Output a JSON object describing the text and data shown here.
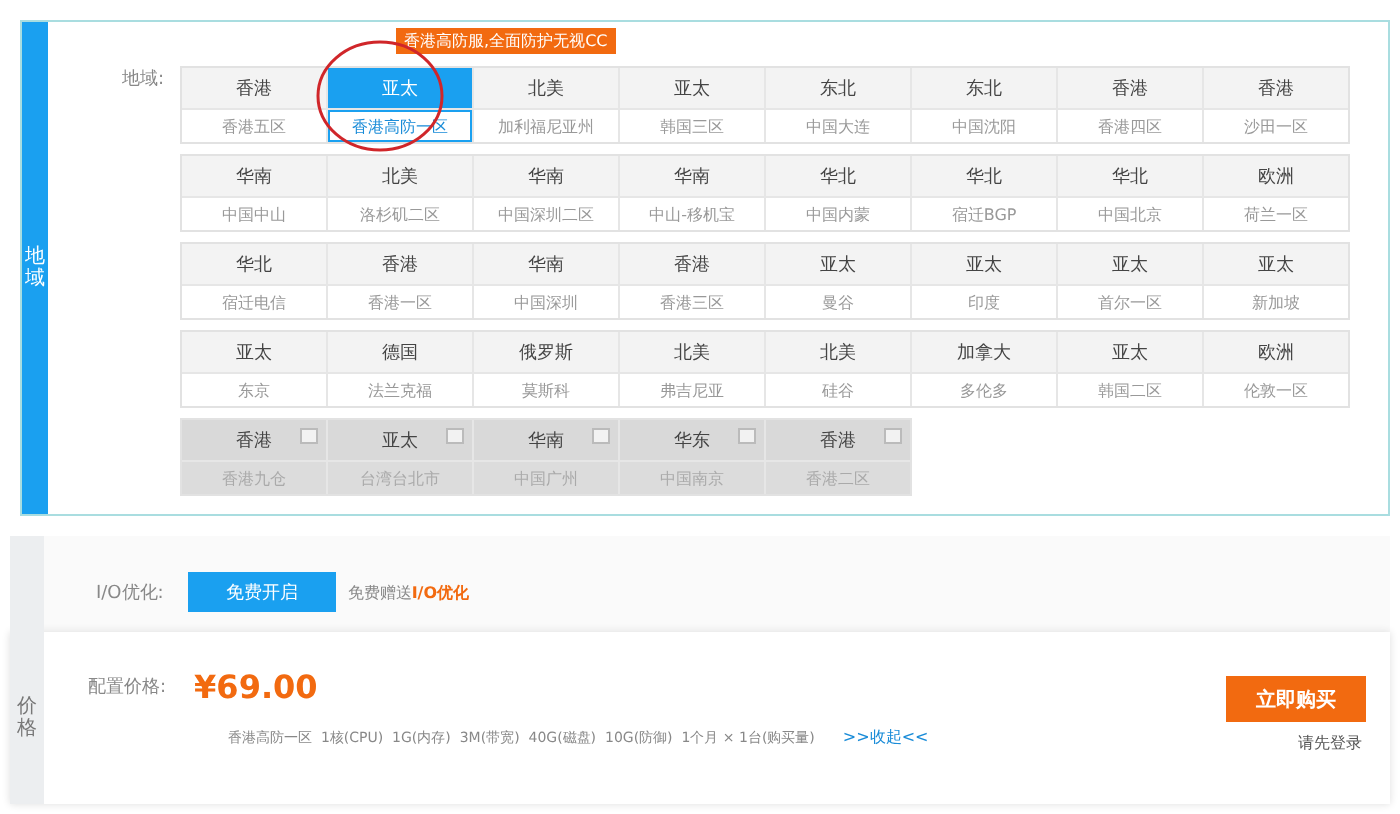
{
  "region_section": {
    "side_label": "地域",
    "label": "地域:",
    "tooltip": "香港高防服,全面防护无视CC",
    "rows": [
      [
        {
          "area": "香港",
          "name": "香港五区",
          "selected": false,
          "disabled": false
        },
        {
          "area": "亚太",
          "name": "香港高防一区",
          "selected": true,
          "disabled": false
        },
        {
          "area": "北美",
          "name": "加利福尼亚州",
          "selected": false,
          "disabled": false
        },
        {
          "area": "亚太",
          "name": "韩国三区",
          "selected": false,
          "disabled": false
        },
        {
          "area": "东北",
          "name": "中国大连",
          "selected": false,
          "disabled": false
        },
        {
          "area": "东北",
          "name": "中国沈阳",
          "selected": false,
          "disabled": false
        },
        {
          "area": "香港",
          "name": "香港四区",
          "selected": false,
          "disabled": false
        },
        {
          "area": "香港",
          "name": "沙田一区",
          "selected": false,
          "disabled": false
        }
      ],
      [
        {
          "area": "华南",
          "name": "中国中山",
          "selected": false,
          "disabled": false
        },
        {
          "area": "北美",
          "name": "洛杉矶二区",
          "selected": false,
          "disabled": false
        },
        {
          "area": "华南",
          "name": "中国深圳二区",
          "selected": false,
          "disabled": false
        },
        {
          "area": "华南",
          "name": "中山-移机宝",
          "selected": false,
          "disabled": false
        },
        {
          "area": "华北",
          "name": "中国内蒙",
          "selected": false,
          "disabled": false
        },
        {
          "area": "华北",
          "name": "宿迁BGP",
          "selected": false,
          "disabled": false
        },
        {
          "area": "华北",
          "name": "中国北京",
          "selected": false,
          "disabled": false
        },
        {
          "area": "欧洲",
          "name": "荷兰一区",
          "selected": false,
          "disabled": false
        }
      ],
      [
        {
          "area": "华北",
          "name": "宿迁电信",
          "selected": false,
          "disabled": false
        },
        {
          "area": "香港",
          "name": "香港一区",
          "selected": false,
          "disabled": false
        },
        {
          "area": "华南",
          "name": "中国深圳",
          "selected": false,
          "disabled": false
        },
        {
          "area": "香港",
          "name": "香港三区",
          "selected": false,
          "disabled": false
        },
        {
          "area": "亚太",
          "name": "曼谷",
          "selected": false,
          "disabled": false
        },
        {
          "area": "亚太",
          "name": "印度",
          "selected": false,
          "disabled": false
        },
        {
          "area": "亚太",
          "name": "首尔一区",
          "selected": false,
          "disabled": false
        },
        {
          "area": "亚太",
          "name": "新加坡",
          "selected": false,
          "disabled": false
        }
      ],
      [
        {
          "area": "亚太",
          "name": "东京",
          "selected": false,
          "disabled": false
        },
        {
          "area": "德国",
          "name": "法兰克福",
          "selected": false,
          "disabled": false
        },
        {
          "area": "俄罗斯",
          "name": "莫斯科",
          "selected": false,
          "disabled": false
        },
        {
          "area": "北美",
          "name": "弗吉尼亚",
          "selected": false,
          "disabled": false
        },
        {
          "area": "北美",
          "name": "硅谷",
          "selected": false,
          "disabled": false
        },
        {
          "area": "加拿大",
          "name": "多伦多",
          "selected": false,
          "disabled": false
        },
        {
          "area": "亚太",
          "name": "韩国二区",
          "selected": false,
          "disabled": false
        },
        {
          "area": "欧洲",
          "name": "伦敦一区",
          "selected": false,
          "disabled": false
        }
      ],
      [
        {
          "area": "香港",
          "name": "香港九仓",
          "selected": false,
          "disabled": true
        },
        {
          "area": "亚太",
          "name": "台湾台北市",
          "selected": false,
          "disabled": true
        },
        {
          "area": "华南",
          "name": "中国广州",
          "selected": false,
          "disabled": true
        },
        {
          "area": "华东",
          "name": "中国南京",
          "selected": false,
          "disabled": true
        },
        {
          "area": "香港",
          "name": "香港二区",
          "selected": false,
          "disabled": true
        }
      ]
    ]
  },
  "io_section": {
    "label": "I/O优化:",
    "button": "免费开启",
    "note": "免费赠送**I/O优化**"
  },
  "price_section": {
    "side_label": "价格",
    "label": "配置价格:",
    "price": "¥69.00",
    "summary": "香港高防一区  1核(CPU)  1G(内存)  3M(带宽)  40G(磁盘)  10G(防御)  1个月 × 1台(购买量)",
    "toggle_link": ">>收起<<",
    "buy_button": "立即购买",
    "login_hint": "请先登录"
  }
}
